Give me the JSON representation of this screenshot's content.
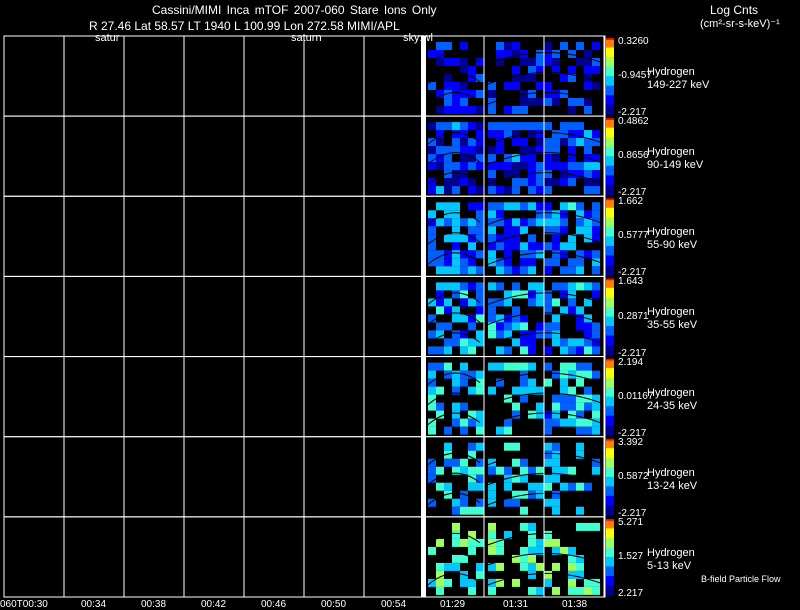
{
  "header": {
    "line1": "Cassini/MIMI Inca mTOF  2007-060  Stare  Ions Only",
    "line2": "R        27.46 Lat 58.57 LT 1940 L        100.99 Lon        272.58  MIMI/APL",
    "row2": [
      "satur",
      "saturn",
      "sky:wl"
    ],
    "units": [
      "Log Cnts",
      "(cm²-sr-s-keV)⁻¹"
    ]
  },
  "footer": "B-field Particle Flow",
  "colors": {
    "background": "#000000",
    "grid": "#ffffff",
    "colormap": [
      "#000090",
      "#0000ff",
      "#0060ff",
      "#00c8ff",
      "#40ffd0",
      "#a0ff60",
      "#ffff00",
      "#ff8000",
      "#ff0000"
    ]
  },
  "chart_data": {
    "type": "heatmap",
    "x_ticks": [
      "060T00:30",
      "00:34",
      "00:38",
      "00:42",
      "00:46",
      "00:50",
      "00:54",
      "01:29",
      "01:31",
      "01:38"
    ],
    "panels": [
      {
        "name": "Hydrogen",
        "energy": "149-227 keV",
        "cb_max": "0.3260",
        "cb_mid": "-0.9457",
        "cb_min": "-2.217",
        "level": 0.18,
        "fill": 0.55
      },
      {
        "name": "Hydrogen",
        "energy": "90-149 keV",
        "cb_max": "0.4862",
        "cb_mid": "0.8656",
        "cb_min": "-2.217",
        "level": 0.22,
        "fill": 0.8
      },
      {
        "name": "Hydrogen",
        "energy": "55-90 keV",
        "cb_max": "1.662",
        "cb_mid": "0.5777",
        "cb_min": "-2.217",
        "level": 0.33,
        "fill": 0.75
      },
      {
        "name": "Hydrogen",
        "energy": "35-55 keV",
        "cb_max": "1.643",
        "cb_mid": "0.2871",
        "cb_min": "-2.217",
        "level": 0.36,
        "fill": 0.65
      },
      {
        "name": "Hydrogen",
        "energy": "24-35 keV",
        "cb_max": "2.194",
        "cb_mid": "0.01167",
        "cb_min": "-2.217",
        "level": 0.42,
        "fill": 0.55
      },
      {
        "name": "Hydrogen",
        "energy": "13-24 keV",
        "cb_max": "3.392",
        "cb_mid": "0.5872",
        "cb_min": "-2.217",
        "level": 0.45,
        "fill": 0.5
      },
      {
        "name": "Hydrogen",
        "energy": "5-13 keV",
        "cb_max": "5.271",
        "cb_mid": "1.527",
        "cb_min": "2.217",
        "level": 0.55,
        "fill": 0.4
      }
    ]
  }
}
